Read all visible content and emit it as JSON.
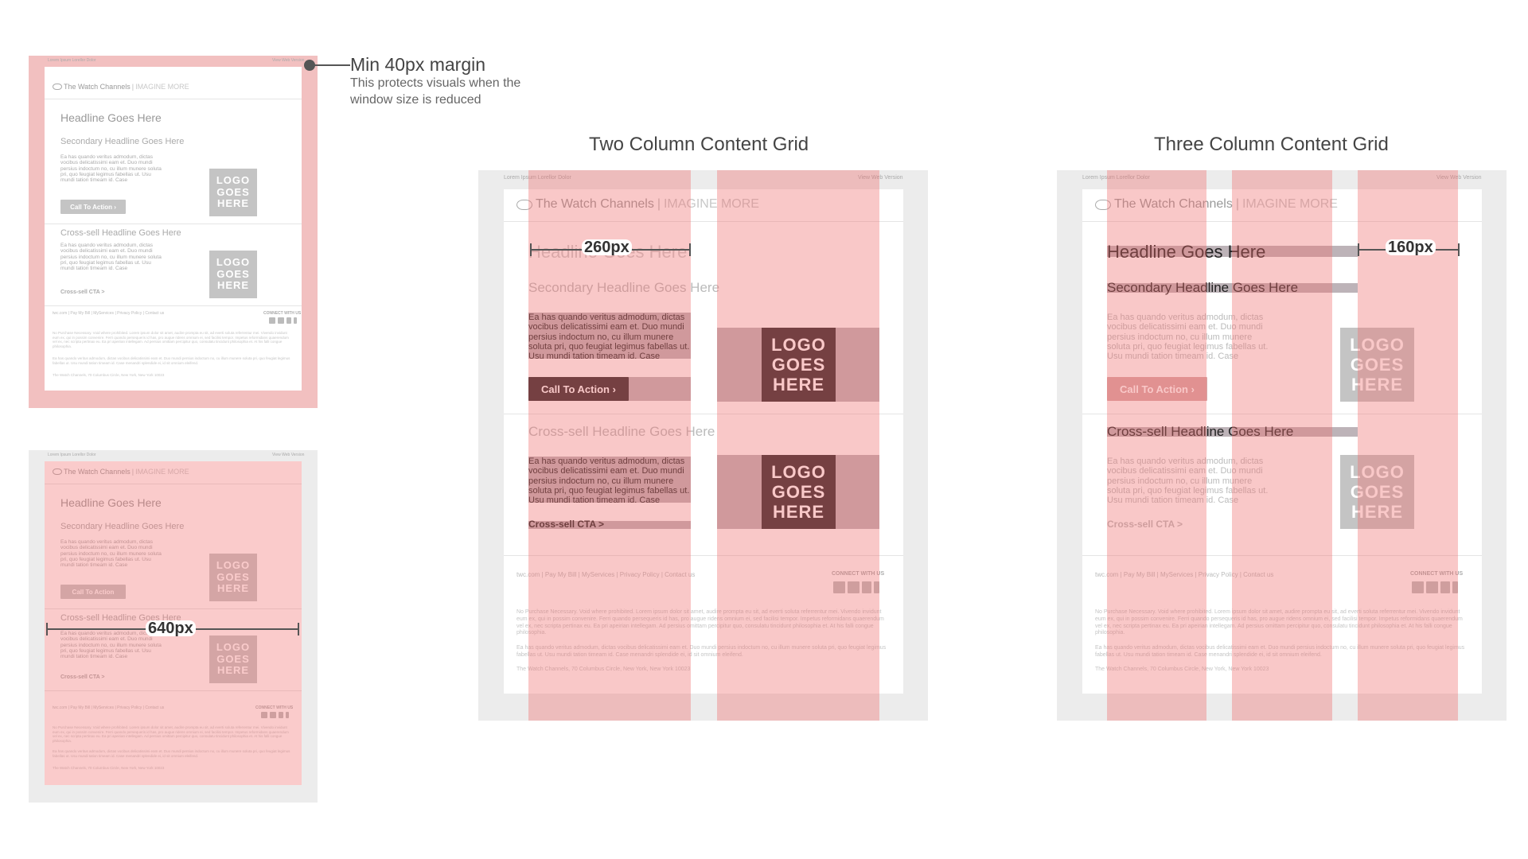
{
  "annotations": {
    "margin_title": "Min 40px margin",
    "margin_desc": "This protects visuals when the window size is reduced",
    "two_col_title": "Two Column Content Grid",
    "three_col_title": "Three Column Content Grid",
    "width_640": "640px",
    "width_260": "260px",
    "width_160": "160px"
  },
  "email": {
    "preheader": "Lorem Ipsum Lorellor Dolor",
    "web_version": "View Web Version",
    "brand": "The Watch Channels",
    "brand_sep": "|",
    "tagline": "IMAGINE MORE",
    "headline": "Headline Goes Here",
    "secondary_headline": "Secondary Headline Goes Here",
    "body_text": "Ea has quando veritus admodum, dictas vocibus delicatissimi eam et. Duo mundi persius indoctum no, cu illum munere soluta pri, quo feugiat legimus fabellas ut. Usu mundi tation timeam id. Case",
    "cta": "Call To Action",
    "cta_arrow": "›",
    "logo_line1": "LOGO",
    "logo_line2": "GOES",
    "logo_line3": "HERE",
    "crosssell_headline": "Cross-sell Headline Goes Here",
    "crosssell_cta": "Cross-sell CTA  >",
    "footer_links": "twc.com   |   Pay My Bill   |   MyServices   |   Privacy Policy   |   Contact us",
    "connect": "CONNECT WITH US",
    "fine_print_1": "No Purchase Necessary. Void where prohibited. Lorem ipsum dolor sit amet, audire prompta eu sit, ad everti soluta referrentur mei. Vivendo invidunt eum ex, qui in possim convenire. Ferri quando persequeris id has, pro augue ridens omnium ei, sed facilisi tempor. Impetus reformidans quaerendum vel ex, nec scripta pertinax eu. Ea pri apeirian intellegam. Ad persius omittam percipitur quo, consulatu tincidunt philosophia et. At his falli congue philosophia.",
    "fine_print_2": "Ea has quando veritus admodum, dictas vocibus delicatissimi eam et. Duo mundi persius indoctum no, cu illum munere soluta pri, quo feugiat legimus fabellas ut. Usu mundi tation timeam id. Case menandri splendide ei, id sit omnium eleifend.",
    "address": "The Watch Channels, 70 Columbus Circle, New York, New York 10023"
  },
  "colors": {
    "grid_overlay": "#f06e6e",
    "panel_bg": "#ececec",
    "dark_block": "#2a2527",
    "highlight_block": "#bdb3b8"
  }
}
